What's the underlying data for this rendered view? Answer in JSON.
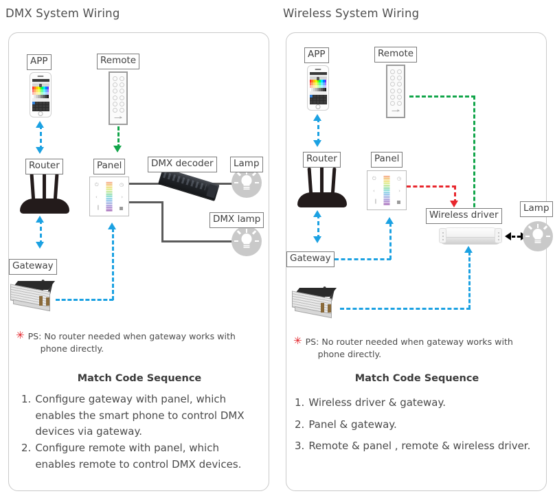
{
  "panels": [
    {
      "title": "DMX System Wiring",
      "labels": {
        "app": "APP",
        "remote": "Remote",
        "router": "Router",
        "panel": "Panel",
        "decoder": "DMX decoder",
        "lamp": "Lamp",
        "dmx_lamp": "DMX lamp",
        "gateway": "Gateway"
      },
      "note": {
        "marker": "✳",
        "line1": "PS: No router needed when gateway works with",
        "line2": "phone directly."
      },
      "sequence_title": "Match Code Sequence",
      "sequence": [
        {
          "num": "1.",
          "text": "Configure gateway with panel, which enables the smart phone to control DMX devices via gateway."
        },
        {
          "num": "2.",
          "text": "Configure remote with panel, which enables remote to control DMX devices."
        }
      ]
    },
    {
      "title": "Wireless System Wiring",
      "labels": {
        "app": "APP",
        "remote": "Remote",
        "router": "Router",
        "panel": "Panel",
        "wireless_driver": "Wireless driver",
        "lamp": "Lamp",
        "gateway": "Gateway"
      },
      "note": {
        "marker": "✳",
        "line1": "PS: No router needed when gateway works with",
        "line2": "phone directly."
      },
      "sequence_title": "Match Code Sequence",
      "sequence": [
        {
          "num": "1.",
          "text": "Wireless driver & gateway."
        },
        {
          "num": "2.",
          "text": "Panel & gateway."
        },
        {
          "num": "3.",
          "text": "Remote & panel , remote & wireless driver."
        }
      ]
    }
  ],
  "colors": {
    "blue_link": "#1ba1e2",
    "green_link": "#12a54a",
    "red_link": "#e8262d",
    "black_link": "#000000",
    "wire_gray": "#5b5b5b",
    "title_gray": "#4d4d4d",
    "note_star_red": "#e3242b"
  },
  "panel_icons": {
    "top_left": "power-icon",
    "top_right": "clock-icon",
    "mid_left": "prev-icon",
    "mid_right": "next-icon",
    "bottom_left": "bar-icon",
    "bottom_right": "stop-icon"
  }
}
